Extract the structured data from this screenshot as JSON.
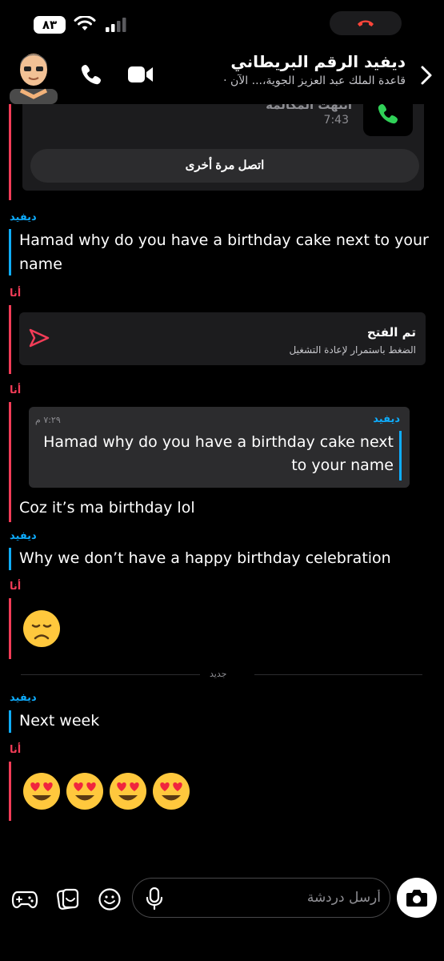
{
  "status_bar": {
    "battery": "٨٣"
  },
  "header": {
    "contact_name": "ديفيد الرقم البريطاني",
    "subtitle": "قاعدة الملك عبد العزيز الجوية،... الآن ·"
  },
  "call_card": {
    "status": "انتهت المكالمة",
    "time": "7:43",
    "callback_label": "اتصل مرة أخرى"
  },
  "messages": {
    "m1_sender": "ديفيد",
    "m1_text_line1": "Hamad why do you have a birthday cake next to your",
    "m1_text_line2": "name",
    "m2_sender": "أنا",
    "m2_title": "تم الفتح",
    "m2_subtitle": "الضغط باستمرار لإعادة التشغيل",
    "m3_sender": "أنا",
    "m3_quote_sender": "ديفيد",
    "m3_quote_time": "٧:٢٩ م",
    "m3_quote_text": "Hamad why do you have a birthday cake next to your name",
    "m3_text": "Coz it’s ma birthday lol",
    "m4_sender": "ديفيد",
    "m4_text": "Why we don’t have a happy birthday celebration",
    "m5_sender": "أنا",
    "m5_emoji": "disappointed-face",
    "divider_label": "جديد",
    "m6_sender": "ديفيد",
    "m6_text": "Next week",
    "m7_sender": "أنا",
    "m7_emoji": "smiling-face-with-heart-eyes x4"
  },
  "input": {
    "placeholder": "أرسل دردشة"
  },
  "colors": {
    "me": "#f23c57",
    "friend": "#0eadff",
    "background": "#000000",
    "card": "#1c1c1e"
  }
}
